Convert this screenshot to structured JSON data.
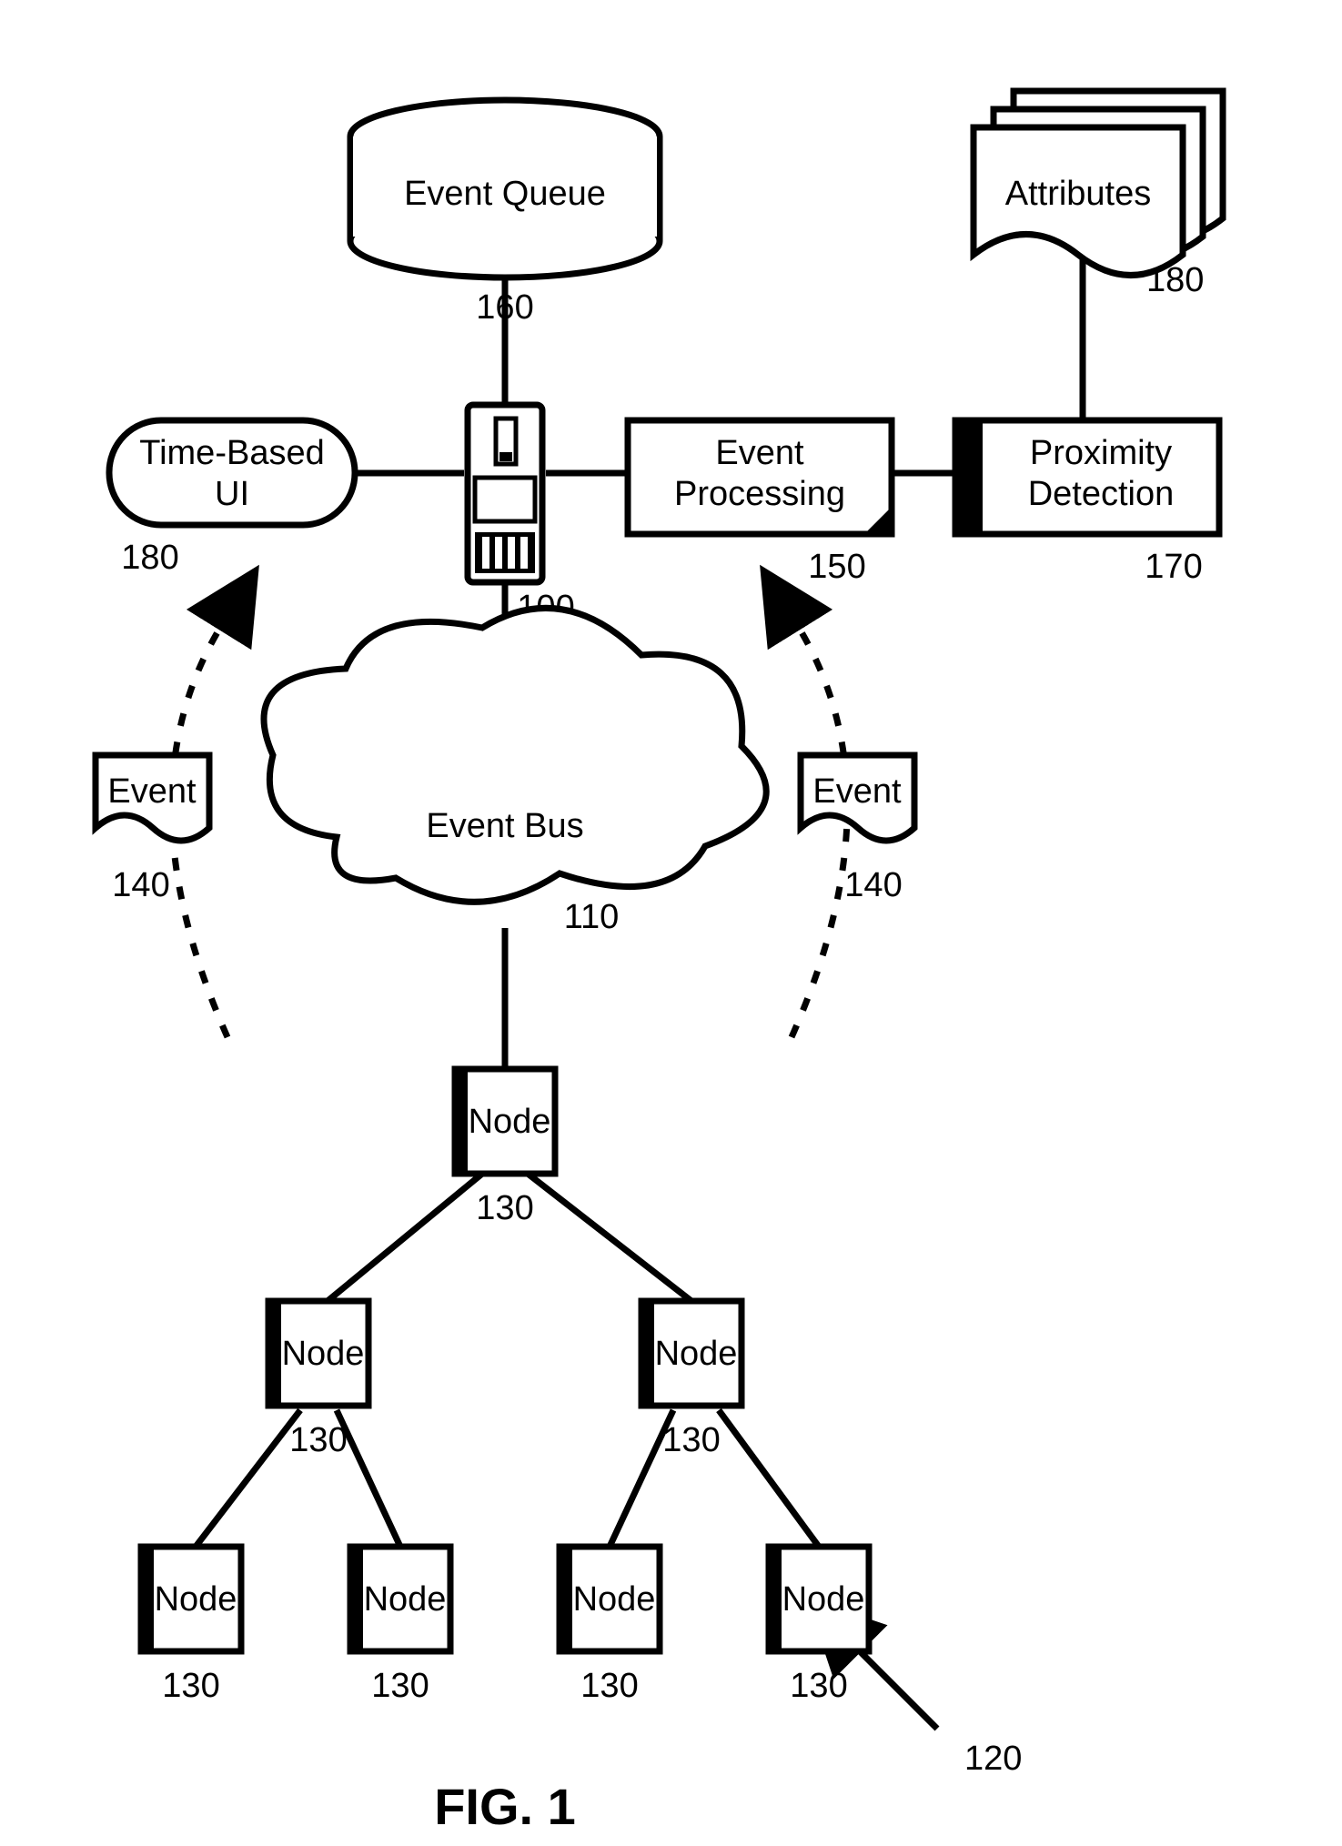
{
  "figure_label": "FIG. 1",
  "blocks": {
    "event_queue": {
      "label": "Event Queue",
      "ref": "160"
    },
    "attributes": {
      "label": "Attributes",
      "ref": "180"
    },
    "time_based_ui": {
      "label": "Time-Based UI",
      "ref": "180"
    },
    "server": {
      "label": "",
      "ref": "100"
    },
    "event_processing": {
      "label": "Event Processing",
      "ref": "150"
    },
    "proximity": {
      "label": "Proximity Detection",
      "ref": "170"
    },
    "event_left": {
      "label": "Event",
      "ref": "140"
    },
    "event_right": {
      "label": "Event",
      "ref": "140"
    },
    "event_bus": {
      "label": "Event Bus",
      "ref": "110"
    },
    "node_root": {
      "label": "Node",
      "ref": "130"
    },
    "node_l": {
      "label": "Node",
      "ref": "130"
    },
    "node_r": {
      "label": "Node",
      "ref": "130"
    },
    "node_ll": {
      "label": "Node",
      "ref": "130"
    },
    "node_lr": {
      "label": "Node",
      "ref": "130"
    },
    "node_rl": {
      "label": "Node",
      "ref": "130"
    },
    "node_rr": {
      "label": "Node",
      "ref": "130"
    },
    "tree": {
      "ref": "120"
    }
  }
}
